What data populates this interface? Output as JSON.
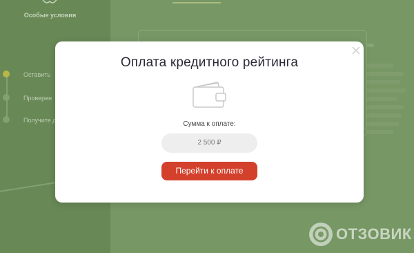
{
  "background": {
    "sidebar": {
      "title": "Особые условия",
      "steps": [
        {
          "label": "Оставить",
          "active": true
        },
        {
          "label": "Проверен",
          "active": false
        },
        {
          "label": "Получите д",
          "active": false
        }
      ]
    },
    "side_fragment": "ии"
  },
  "modal": {
    "title": "Оплата кредитного рейтинга",
    "amount_label": "Сумма к оплате:",
    "amount_value": "2 500 ₽",
    "pay_button": "Перейти к оплате",
    "close_icon": "close-icon",
    "wallet_icon": "wallet-icon"
  },
  "watermark": {
    "text": "ОТЗОВИК"
  },
  "colors": {
    "pay_button": "#d3402b",
    "overlay_green": "#7a9a68",
    "title": "#2b2b38"
  }
}
